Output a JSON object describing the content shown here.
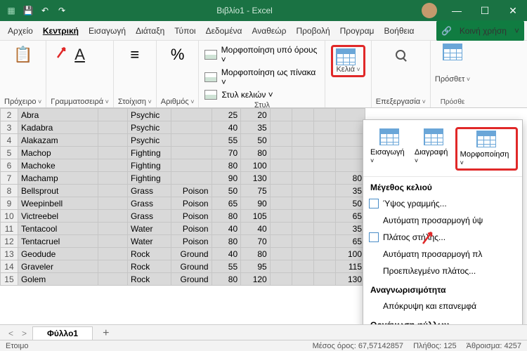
{
  "titlebar": {
    "title": "Βιβλίο1 - Excel"
  },
  "menu": {
    "items": [
      "Αρχείο",
      "Κεντρική",
      "Εισαγωγή",
      "Διάταξη",
      "Τύποι",
      "Δεδομένα",
      "Αναθεώρ",
      "Προβολή",
      "Προγραμ",
      "Βοήθεια"
    ],
    "active_index": 1,
    "share": "Κοινή χρήση"
  },
  "ribbon": {
    "clipboard": "Πρόχειρο",
    "font": "Γραμματοσειρά",
    "align": "Στοίχιση",
    "number": "Αριθμός",
    "styles_label": "Στυλ",
    "cond": "Μορφοποίηση υπό όρους ˅",
    "table": "Μορφοποίηση ως πίνακα ˅",
    "cellstyles": "Στυλ κελιών ˅",
    "cells": "Κελιά",
    "editing": "Επεξεργασία",
    "addins": "Πρόσθετ",
    "addins_label": "Πρόσθε"
  },
  "dropdown": {
    "insert": "Εισαγωγή",
    "delete": "Διαγραφή",
    "format": "Μορφοποίηση",
    "section_size": "Μέγεθος κελιού",
    "row_height": "Ύψος γραμμής...",
    "auto_row": "Αυτόματη προσαρμογή ύψ",
    "col_width": "Πλάτος στήλης...",
    "auto_col": "Αυτόματη προσαρμογή πλ",
    "default_w": "Προεπιλεγμένο πλάτος...",
    "section_vis": "Αναγνωρισιμότητα",
    "hide": "Απόκρυψη και επανεμφά",
    "section_org": "Οργάνωση φύλλων"
  },
  "sheet_data": {
    "rows": [
      {
        "n": 2,
        "c": [
          "Abra",
          "",
          "Psychic",
          "",
          "25",
          "20",
          "",
          "",
          "",
          ""
        ]
      },
      {
        "n": 3,
        "c": [
          "Kadabra",
          "",
          "Psychic",
          "",
          "40",
          "35",
          "",
          "",
          "",
          ""
        ]
      },
      {
        "n": 4,
        "c": [
          "Alakazam",
          "",
          "Psychic",
          "",
          "55",
          "50",
          "",
          "",
          "",
          ""
        ]
      },
      {
        "n": 5,
        "c": [
          "Machop",
          "",
          "Fighting",
          "",
          "70",
          "80",
          "",
          "",
          "",
          ""
        ]
      },
      {
        "n": 6,
        "c": [
          "Machoke",
          "",
          "Fighting",
          "",
          "80",
          "100",
          "",
          "",
          "",
          ""
        ]
      },
      {
        "n": 7,
        "c": [
          "Machamp",
          "",
          "Fighting",
          "",
          "90",
          "130",
          "",
          "",
          "",
          "80"
        ]
      },
      {
        "n": 8,
        "c": [
          "Bellsprout",
          "",
          "Grass",
          "Poison",
          "50",
          "75",
          "",
          "",
          "",
          "35"
        ]
      },
      {
        "n": 9,
        "c": [
          "Weepinbell",
          "",
          "Grass",
          "Poison",
          "65",
          "90",
          "",
          "",
          "",
          "50"
        ]
      },
      {
        "n": 10,
        "c": [
          "Victreebel",
          "",
          "Grass",
          "Poison",
          "80",
          "105",
          "",
          "",
          "",
          "65"
        ]
      },
      {
        "n": 11,
        "c": [
          "Tentacool",
          "",
          "Water",
          "Poison",
          "40",
          "40",
          "",
          "",
          "",
          "35"
        ]
      },
      {
        "n": 12,
        "c": [
          "Tentacruel",
          "",
          "Water",
          "Poison",
          "80",
          "70",
          "",
          "",
          "",
          "65"
        ]
      },
      {
        "n": 13,
        "c": [
          "Geodude",
          "",
          "Rock",
          "Ground",
          "40",
          "80",
          "",
          "",
          "",
          "100"
        ]
      },
      {
        "n": 14,
        "c": [
          "Graveler",
          "",
          "Rock",
          "Ground",
          "55",
          "95",
          "",
          "",
          "",
          "115"
        ]
      },
      {
        "n": 15,
        "c": [
          "Golem",
          "",
          "Rock",
          "Ground",
          "80",
          "120",
          "",
          "",
          "",
          "130"
        ]
      }
    ]
  },
  "tabs": {
    "sheet1": "Φύλλο1"
  },
  "status": {
    "ready": "Ετοιμο",
    "avg": "Μέσος όρος: 67,57142857",
    "count": "Πλήθος: 125",
    "sum": "Άθροισμα: 4257"
  }
}
